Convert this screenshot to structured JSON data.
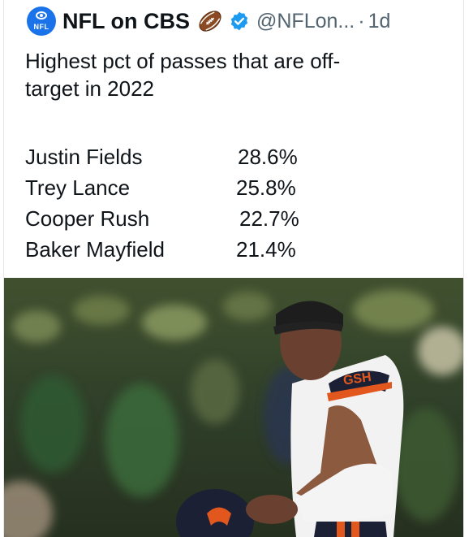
{
  "account": {
    "name": "NFL on CBS",
    "handle": "@NFLon...",
    "separator": "·",
    "time": "1d",
    "avatar_label": "NFL",
    "verified": true
  },
  "tweet": {
    "line1": "Highest pct of passes that are off-",
    "line2": "target in 2022",
    "stats": [
      {
        "name": "Justin Fields",
        "value": "28.6%"
      },
      {
        "name": "Trey Lance",
        "value": "25.8%"
      },
      {
        "name": "Cooper Rush",
        "value": "22.7%"
      },
      {
        "name": "Baker Mayfield",
        "value": "21.4%"
      }
    ]
  },
  "photo": {
    "jersey_text": "GSH",
    "icons": [
      "cbs-eye-icon",
      "football-icon",
      "verified-badge-icon"
    ]
  },
  "colors": {
    "accent_blue": "#1d9bf0",
    "text": "#0f1419",
    "muted": "#536471",
    "bears_navy": "#1b2035",
    "bears_orange": "#e2571d",
    "stadium_green": "#3d5a32"
  }
}
